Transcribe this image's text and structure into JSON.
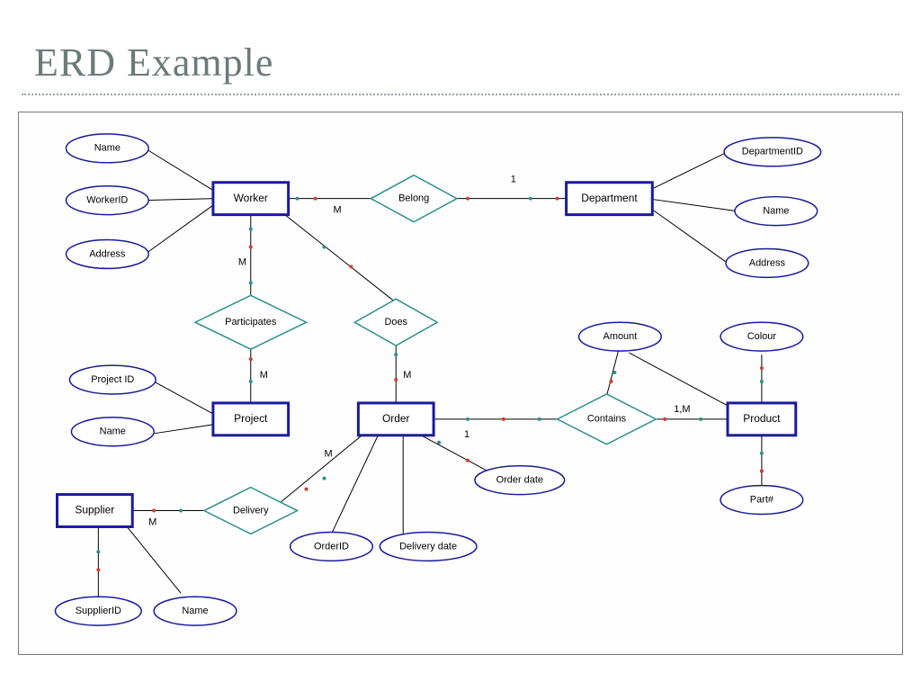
{
  "slide": {
    "title": "ERD Example"
  },
  "entities": {
    "worker": {
      "label": "Worker"
    },
    "department": {
      "label": "Department"
    },
    "project": {
      "label": "Project"
    },
    "order": {
      "label": "Order"
    },
    "product": {
      "label": "Product"
    },
    "supplier": {
      "label": "Supplier"
    }
  },
  "attributes": {
    "worker_name": {
      "label": "Name"
    },
    "worker_id": {
      "label": "WorkerID"
    },
    "worker_address": {
      "label": "Address"
    },
    "dept_id": {
      "label": "DepartmentID"
    },
    "dept_name": {
      "label": "Name"
    },
    "dept_address": {
      "label": "Address"
    },
    "project_id": {
      "label": "Project ID"
    },
    "project_name": {
      "label": "Name"
    },
    "order_date": {
      "label": "Order date"
    },
    "order_id": {
      "label": "OrderID"
    },
    "delivery_date": {
      "label": "Delivery date"
    },
    "amount": {
      "label": "Amount"
    },
    "colour": {
      "label": "Colour"
    },
    "part_no": {
      "label": "Part#"
    },
    "supplier_id": {
      "label": "SupplierID"
    },
    "supplier_name": {
      "label": "Name"
    }
  },
  "relationships": {
    "belong": {
      "label": "Belong"
    },
    "participates": {
      "label": "Participates"
    },
    "does": {
      "label": "Does"
    },
    "contains": {
      "label": "Contains"
    },
    "delivery": {
      "label": "Delivery"
    }
  },
  "cardinality": {
    "belong_worker": "M",
    "belong_dept": "1",
    "participates_worker": "M",
    "participates_project": "M",
    "does_order": "M",
    "contains_order": "1",
    "contains_product": "1,M",
    "delivery_order": "M",
    "delivery_supplier": "M"
  }
}
